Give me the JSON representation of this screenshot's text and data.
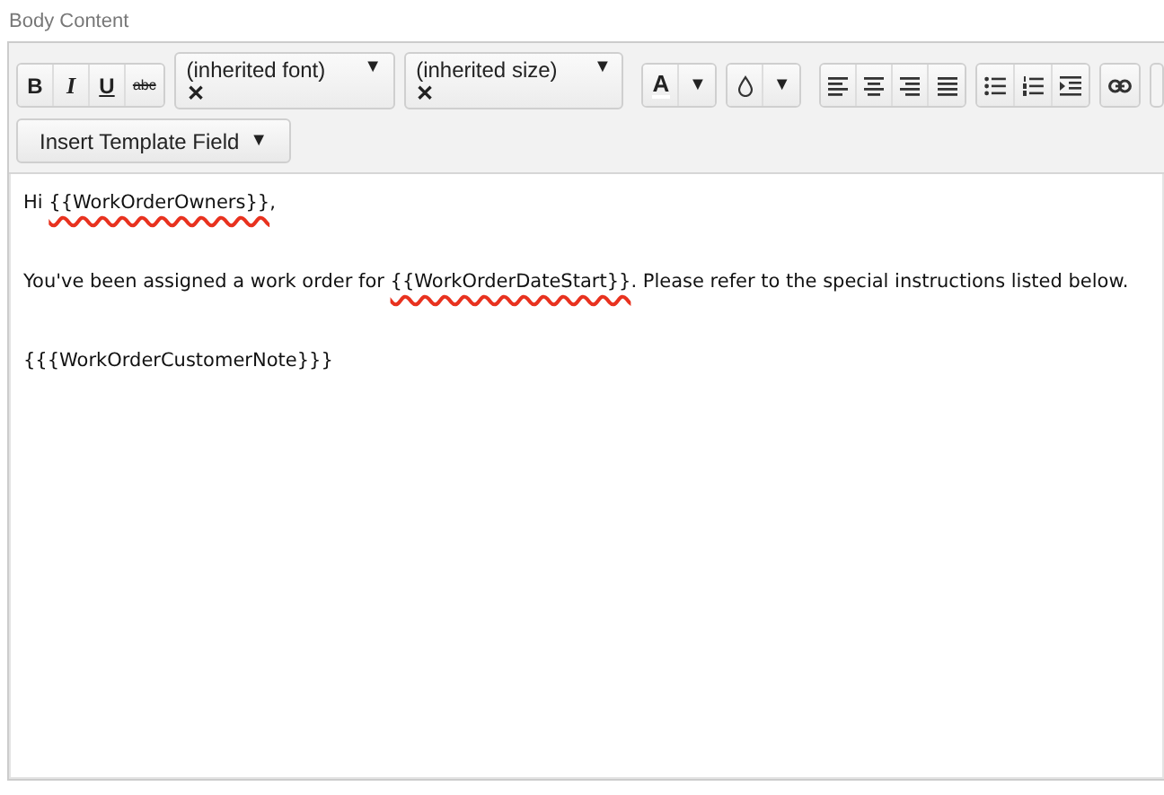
{
  "label": "Body Content",
  "toolbar": {
    "format_buttons": [
      {
        "kind": "bold",
        "label": "B"
      },
      {
        "kind": "italic",
        "label": "I"
      },
      {
        "kind": "underline",
        "label": "U"
      },
      {
        "kind": "strike",
        "label": "abc"
      }
    ],
    "font_select": {
      "value": "(inherited font)",
      "arrow": "▼",
      "clear": "✕"
    },
    "size_select": {
      "value": "(inherited size)",
      "arrow": "▼",
      "clear": "✕"
    },
    "color_button": {
      "label": "A",
      "arrow": "▼"
    },
    "highlight_button": {
      "arrow": "▼"
    },
    "insert_button": {
      "label": "Insert Template Field",
      "arrow": "▼"
    }
  },
  "paragraphs": [
    {
      "segments": [
        {
          "text": "Hi "
        },
        {
          "text": "{{WorkOrderOwners}}",
          "misspelled": true
        },
        {
          "text": ","
        }
      ]
    },
    {
      "segments": [
        {
          "text": "You've been assigned a work order for "
        },
        {
          "text": "{{WorkOrderDateStart}}",
          "misspelled": true
        },
        {
          "text": ". Please refer to the special instructions listed below."
        }
      ]
    },
    {
      "segments": [
        {
          "text": "{{{WorkOrderCustomerNote}}}"
        }
      ]
    }
  ]
}
